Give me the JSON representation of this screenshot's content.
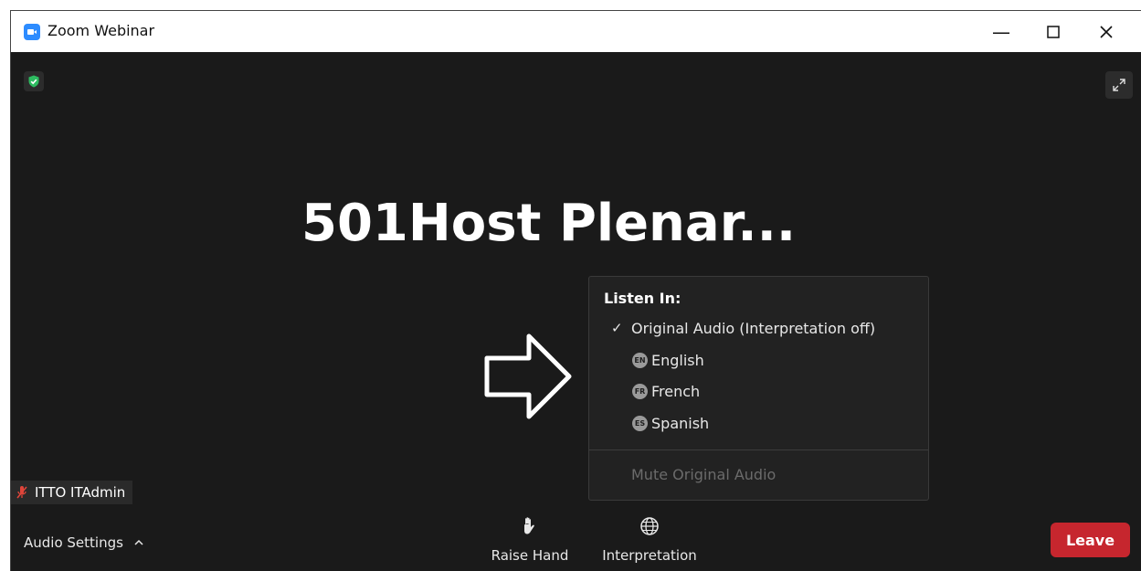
{
  "window": {
    "title": "Zoom Webinar"
  },
  "stage": {
    "title": "501Host Plenar..."
  },
  "listen_menu": {
    "header": "Listen In:",
    "original_audio": "Original Audio (Interpretation off)",
    "languages": [
      {
        "code": "EN",
        "label": "English"
      },
      {
        "code": "FR",
        "label": "French"
      },
      {
        "code": "ES",
        "label": "Spanish"
      }
    ],
    "mute_original": "Mute Original Audio"
  },
  "participant": {
    "name": "ITTO ITAdmin"
  },
  "toolbar": {
    "audio_settings": "Audio Settings",
    "raise_hand": "Raise Hand",
    "interpretation": "Interpretation",
    "leave": "Leave"
  },
  "colors": {
    "background": "#1a1a1a",
    "accent": "#2d8cff",
    "leave": "#c6262e",
    "shield": "#2dbb60"
  },
  "icons": {
    "app": "zoom-app-icon",
    "shield": "shield-check-icon",
    "fullscreen": "expand-icon",
    "muted_mic": "muted-microphone-icon",
    "raise_hand": "hand-icon",
    "interpretation": "globe-icon"
  }
}
